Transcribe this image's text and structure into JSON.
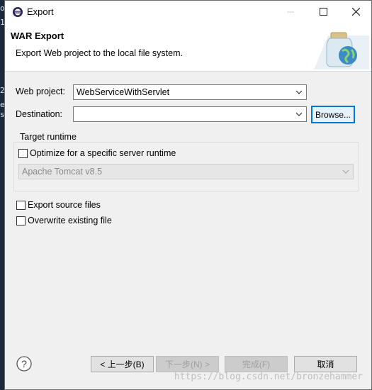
{
  "window": {
    "title": "Export"
  },
  "header": {
    "title": "WAR Export",
    "message": "Export Web project to the local file system."
  },
  "form": {
    "web_project_label": "Web project:",
    "web_project_value": "WebServiceWithServlet",
    "destination_label": "Destination:",
    "destination_value": "",
    "browse_label": "Browse...",
    "target_runtime_group": "Target runtime",
    "optimize_label": "Optimize for a specific server runtime",
    "optimize_checked": false,
    "runtime_value": "Apache Tomcat v8.5",
    "export_source_label": "Export source files",
    "export_source_checked": false,
    "overwrite_label": "Overwrite existing file",
    "overwrite_checked": false
  },
  "footer": {
    "back_label": "< 上一步(B)",
    "next_label": "下一步(N) >",
    "finish_label": "完成(F)",
    "cancel_label": "取消"
  },
  "watermark": "https://blog.csdn.net/bronzehammer",
  "colors": {
    "focus": "#0078d7",
    "header_bg": "#ffffff",
    "dialog_bg": "#f0f0f0"
  }
}
